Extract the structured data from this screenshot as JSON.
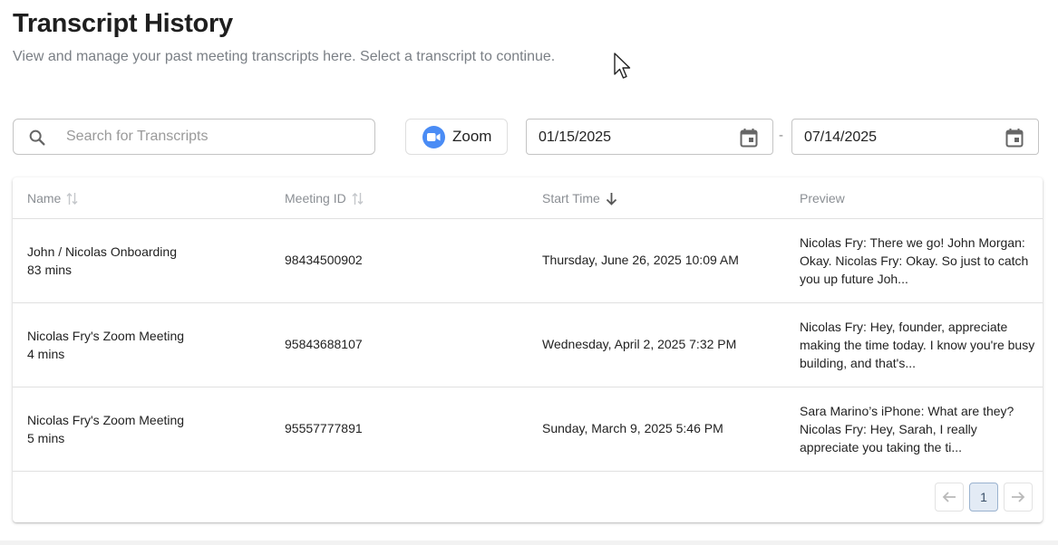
{
  "header": {
    "title": "Transcript History",
    "subtitle": "View and manage your past meeting transcripts here. Select a transcript to continue."
  },
  "filters": {
    "search_placeholder": "Search for Transcripts",
    "platform_label": "Zoom",
    "date_start": "01/15/2025",
    "date_separator": "-",
    "date_end": "07/14/2025"
  },
  "table": {
    "columns": {
      "name": "Name",
      "meeting_id": "Meeting ID",
      "start_time": "Start Time",
      "preview": "Preview"
    },
    "sort": {
      "column": "Start Time",
      "direction": "descending"
    },
    "rows": [
      {
        "name": "John / Nicolas Onboarding",
        "duration": "83 mins",
        "meeting_id": "98434500902",
        "start_time": "Thursday, June 26, 2025 10:09 AM",
        "preview": "Nicolas Fry: There we go! John Morgan: Okay. Nicolas Fry: Okay. So just to catch you up future Joh..."
      },
      {
        "name": "Nicolas Fry's Zoom Meeting",
        "duration": "4 mins",
        "meeting_id": "95843688107",
        "start_time": "Wednesday, April 2, 2025 7:32 PM",
        "preview": "Nicolas Fry: Hey, founder, appreciate making the time today. I know you're busy building, and that's..."
      },
      {
        "name": "Nicolas Fry's Zoom Meeting",
        "duration": "5 mins",
        "meeting_id": "95557777891",
        "start_time": "Sunday, March 9, 2025 5:46 PM",
        "preview": "Sara Marino’s iPhone: What are they? Nicolas Fry: Hey, Sarah, I really appreciate you taking the ti..."
      }
    ]
  },
  "pagination": {
    "current_page": "1"
  },
  "icons": {
    "search": "search-icon",
    "zoom": "zoom-logo-icon",
    "calendar": "calendar-icon",
    "sort": "sort-icon",
    "sort_desc": "arrow-down-icon",
    "prev": "arrow-left-icon",
    "next": "arrow-right-icon"
  },
  "colors": {
    "zoom_blue": "#4a8cf5",
    "active_page_bg": "#e3ebf5"
  }
}
